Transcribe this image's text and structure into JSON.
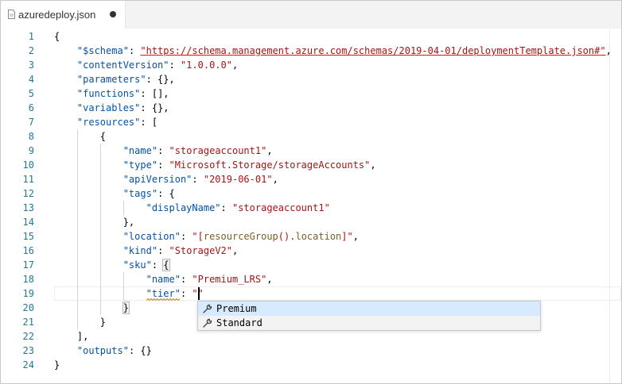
{
  "tab": {
    "title": "azuredeploy.json",
    "icon": "json-file-icon",
    "modified": true
  },
  "line_numbers": [
    "1",
    "2",
    "3",
    "4",
    "5",
    "6",
    "7",
    "8",
    "9",
    "10",
    "11",
    "12",
    "13",
    "14",
    "15",
    "16",
    "17",
    "18",
    "19",
    "20",
    "21",
    "22",
    "23",
    "24"
  ],
  "code_lines": [
    [
      {
        "t": "p",
        "v": "{"
      }
    ],
    [
      {
        "t": "p",
        "v": "    "
      },
      {
        "t": "k",
        "v": "\"$schema\""
      },
      {
        "t": "p",
        "v": ": "
      },
      {
        "t": "su",
        "v": "\"https://schema.management.azure.com/schemas/2019-04-01/deploymentTemplate.json#\""
      },
      {
        "t": "p",
        "v": ","
      }
    ],
    [
      {
        "t": "p",
        "v": "    "
      },
      {
        "t": "k",
        "v": "\"contentVersion\""
      },
      {
        "t": "p",
        "v": ": "
      },
      {
        "t": "s",
        "v": "\"1.0.0.0\""
      },
      {
        "t": "p",
        "v": ","
      }
    ],
    [
      {
        "t": "p",
        "v": "    "
      },
      {
        "t": "k",
        "v": "\"parameters\""
      },
      {
        "t": "p",
        "v": ": {},"
      }
    ],
    [
      {
        "t": "p",
        "v": "    "
      },
      {
        "t": "k",
        "v": "\"functions\""
      },
      {
        "t": "p",
        "v": ": [],"
      }
    ],
    [
      {
        "t": "p",
        "v": "    "
      },
      {
        "t": "k",
        "v": "\"variables\""
      },
      {
        "t": "p",
        "v": ": {},"
      }
    ],
    [
      {
        "t": "p",
        "v": "    "
      },
      {
        "t": "k",
        "v": "\"resources\""
      },
      {
        "t": "p",
        "v": ": ["
      }
    ],
    [
      {
        "t": "p",
        "v": "        {"
      }
    ],
    [
      {
        "t": "p",
        "v": "            "
      },
      {
        "t": "k",
        "v": "\"name\""
      },
      {
        "t": "p",
        "v": ": "
      },
      {
        "t": "s",
        "v": "\"storageaccount1\""
      },
      {
        "t": "p",
        "v": ","
      }
    ],
    [
      {
        "t": "p",
        "v": "            "
      },
      {
        "t": "k",
        "v": "\"type\""
      },
      {
        "t": "p",
        "v": ": "
      },
      {
        "t": "s",
        "v": "\"Microsoft.Storage/storageAccounts\""
      },
      {
        "t": "p",
        "v": ","
      }
    ],
    [
      {
        "t": "p",
        "v": "            "
      },
      {
        "t": "k",
        "v": "\"apiVersion\""
      },
      {
        "t": "p",
        "v": ": "
      },
      {
        "t": "s",
        "v": "\"2019-06-01\""
      },
      {
        "t": "p",
        "v": ","
      }
    ],
    [
      {
        "t": "p",
        "v": "            "
      },
      {
        "t": "k",
        "v": "\"tags\""
      },
      {
        "t": "p",
        "v": ": {"
      }
    ],
    [
      {
        "t": "p",
        "v": "                "
      },
      {
        "t": "k",
        "v": "\"displayName\""
      },
      {
        "t": "p",
        "v": ": "
      },
      {
        "t": "s",
        "v": "\"storageaccount1\""
      }
    ],
    [
      {
        "t": "p",
        "v": "            },"
      }
    ],
    [
      {
        "t": "p",
        "v": "            "
      },
      {
        "t": "k",
        "v": "\"location\""
      },
      {
        "t": "p",
        "v": ": "
      },
      {
        "t": "s",
        "v": "\"["
      },
      {
        "t": "f",
        "v": "resourceGroup"
      },
      {
        "t": "s",
        "v": "()."
      },
      {
        "t": "f",
        "v": "location"
      },
      {
        "t": "s",
        "v": "]\""
      },
      {
        "t": "p",
        "v": ","
      }
    ],
    [
      {
        "t": "p",
        "v": "            "
      },
      {
        "t": "k",
        "v": "\"kind\""
      },
      {
        "t": "p",
        "v": ": "
      },
      {
        "t": "s",
        "v": "\"StorageV2\""
      },
      {
        "t": "p",
        "v": ","
      }
    ],
    [
      {
        "t": "p",
        "v": "            "
      },
      {
        "t": "k",
        "v": "\"sku\""
      },
      {
        "t": "p",
        "v": ": "
      },
      {
        "t": "m",
        "v": "{"
      }
    ],
    [
      {
        "t": "p",
        "v": "                "
      },
      {
        "t": "k",
        "v": "\"name\""
      },
      {
        "t": "p",
        "v": ": "
      },
      {
        "t": "s",
        "v": "\"Premium_LRS\""
      },
      {
        "t": "p",
        "v": ","
      }
    ],
    [
      {
        "t": "p",
        "v": "                "
      },
      {
        "t": "k",
        "v": "\"tier\""
      },
      {
        "t": "p",
        "v": ": "
      },
      {
        "t": "s",
        "v": "\"\""
      }
    ],
    [
      {
        "t": "p",
        "v": "            "
      },
      {
        "t": "m",
        "v": "}"
      }
    ],
    [
      {
        "t": "p",
        "v": "        }"
      }
    ],
    [
      {
        "t": "p",
        "v": "    ],"
      }
    ],
    [
      {
        "t": "p",
        "v": "    "
      },
      {
        "t": "k",
        "v": "\"outputs\""
      },
      {
        "t": "p",
        "v": ": {}"
      }
    ],
    [
      {
        "t": "p",
        "v": "}"
      }
    ]
  ],
  "suggestions": [
    {
      "label": "Premium",
      "icon": "wrench-icon",
      "selected": true
    },
    {
      "label": "Standard",
      "icon": "wrench-icon",
      "selected": false
    }
  ],
  "colors": {
    "json_key": "#0451a5",
    "json_string": "#a31515",
    "function": "#795e26",
    "line_number": "#237893",
    "error_underline": "#e51400",
    "warning_squiggle": "#bf8803",
    "suggest_selected": "#d6ebff"
  }
}
